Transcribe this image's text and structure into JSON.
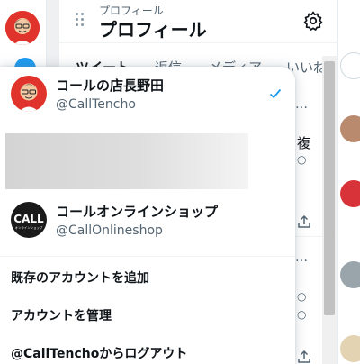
{
  "colors": {
    "accent": "#1d9bf0",
    "background": "#f2f3f4",
    "primary_text": "#0f1419",
    "secondary_text": "#536471"
  },
  "header": {
    "subtitle": "プロフィール",
    "title": "プロフィール",
    "settings_icon": "gear-icon"
  },
  "tabs": [
    {
      "label": "ツイート"
    },
    {
      "label": "返信"
    },
    {
      "label": "メディア"
    },
    {
      "label": "いいね"
    }
  ],
  "feed_fragments": {
    "more_label": "…",
    "text_1": "複",
    "text_2": "○",
    "text_3": "○",
    "text_4": "○"
  },
  "account_menu": {
    "accounts": [
      {
        "name": "コールの店長野田",
        "handle": "@CallTencho",
        "selected": true
      },
      {
        "name": "コールオンラインショップ",
        "handle": "@CallOnlineshop",
        "avatar_text": "CALL",
        "avatar_subtext": "オンラインショップ"
      }
    ],
    "actions": [
      {
        "label": "既存のアカウントを追加"
      },
      {
        "label": "アカウントを管理"
      },
      {
        "label": "@CallTenchoからログアウト"
      }
    ]
  }
}
